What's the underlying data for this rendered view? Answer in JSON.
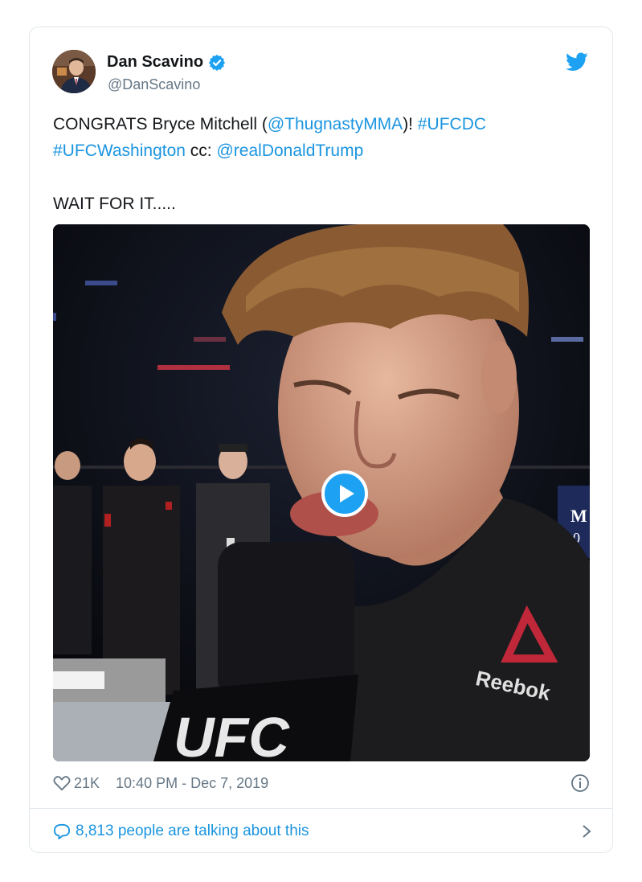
{
  "author": {
    "display_name": "Dan Scavino",
    "handle": "@DanScavino",
    "verified": true,
    "avatar_icon": "user-avatar"
  },
  "tweet": {
    "text_prefix": "CONGRATS Bryce Mitchell (",
    "mention_1": "@ThugnastyMMA",
    "text_mid": ")! ",
    "hashtag_1": "#UFCDC",
    "hashtag_2": "#UFCWashington",
    "text_cc": " cc: ",
    "mention_2": "@realDonaldTrump",
    "line_2": "WAIT FOR IT....."
  },
  "media": {
    "type": "video",
    "play_icon": "play-icon",
    "shirt_brand": "Reebok",
    "mic_text": "UFC",
    "corner_sign": "M\n0"
  },
  "footer": {
    "likes": "21K",
    "timestamp": "10:40 PM - Dec 7, 2019",
    "talking": "8,813 people are talking about this"
  },
  "colors": {
    "link": "#1b95e0",
    "twitter_blue": "#1da1f2",
    "muted": "#657786",
    "border": "#e1e8ed"
  }
}
